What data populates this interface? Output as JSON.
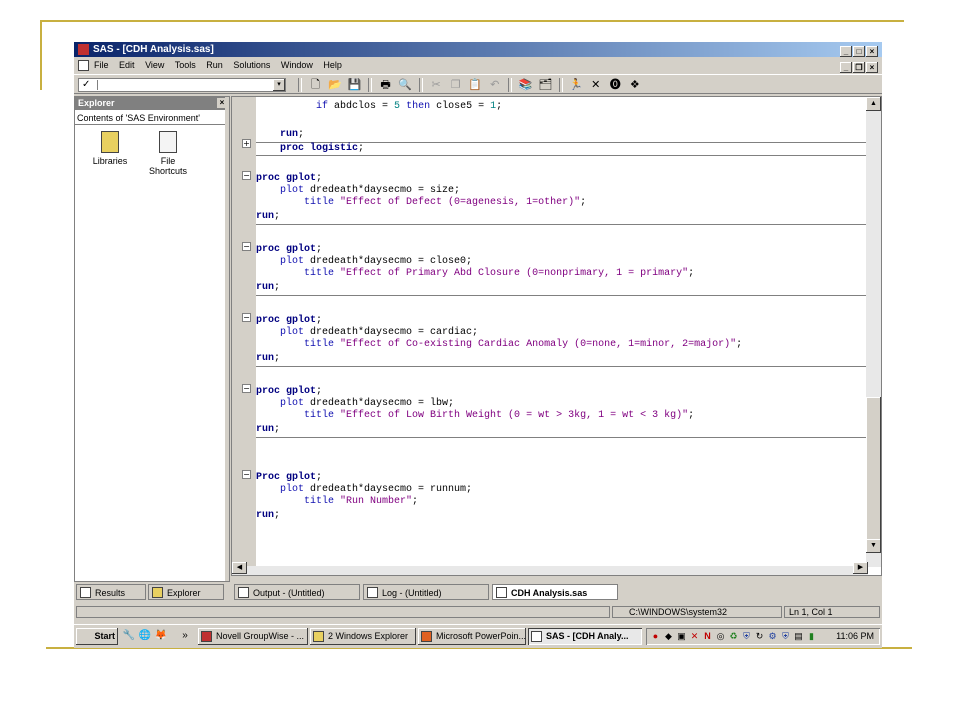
{
  "window": {
    "title": "SAS - [CDH Analysis.sas]",
    "controls": {
      "minimize": "_",
      "maximize": "□",
      "close": "×",
      "restore": "❐"
    }
  },
  "menu": [
    "File",
    "Edit",
    "View",
    "Tools",
    "Run",
    "Solutions",
    "Window",
    "Help"
  ],
  "toolbar": {
    "command_check": "✓",
    "dropdown_arrow": "▾",
    "icons": [
      "new-icon",
      "open-icon",
      "save-icon",
      "print-icon",
      "print-preview-icon",
      "cut-icon",
      "copy-icon",
      "paste-icon",
      "undo-icon",
      "library-icon",
      "explorer-icon",
      "run-icon",
      "clear-icon",
      "break-icon",
      "help-icon"
    ]
  },
  "explorer": {
    "title": "Explorer",
    "close": "×",
    "contents_label": "Contents of 'SAS Environment'",
    "items": [
      {
        "label": "Libraries",
        "icon": "libraries-icon"
      },
      {
        "label": "File Shortcuts",
        "icon": "file-shortcuts-icon"
      }
    ]
  },
  "editor": {
    "lines": {
      "l1": {
        "indent": "          ",
        "kw1": "if",
        "t1": " abdclos = ",
        "num": "5",
        "t2": " ",
        "kw2": "then",
        "t3": " close5 = ",
        "num2": "1",
        "t4": ";"
      },
      "l2": {
        "indent": "    ",
        "kw": "run",
        "t": ";"
      },
      "l3": {
        "indent": "    ",
        "kw": "proc logistic",
        "t": ";"
      },
      "b1": {
        "head": "proc gplot",
        "t": ";",
        "plot_kw": "plot",
        "plot": " dredeath*daysecmo = size;",
        "title_kw": "title",
        "title_str": " \"Effect of Defect (0=agenesis, 1=other)\"",
        "semi": ";",
        "run": "run",
        "run_semi": ";"
      },
      "b2": {
        "head": "proc gplot",
        "t": ";",
        "plot_kw": "plot",
        "plot": " dredeath*daysecmo = close0;",
        "title_kw": "title",
        "title_str": " \"Effect of Primary Abd Closure (0=nonprimary, 1 = primary\"",
        "semi": ";",
        "run": "run",
        "run_semi": ";"
      },
      "b3": {
        "head": "proc gplot",
        "t": ";",
        "plot_kw": "plot",
        "plot": " dredeath*daysecmo = cardiac;",
        "title_kw": "title",
        "title_str": " \"Effect of Co-existing Cardiac Anomaly (0=none, 1=minor, 2=major)\"",
        "semi": ";",
        "run": "run",
        "run_semi": ";"
      },
      "b4": {
        "head": "proc gplot",
        "t": ";",
        "plot_kw": "plot",
        "plot": " dredeath*daysecmo = lbw;",
        "title_kw": "title",
        "title_str": " \"Effect of Low Birth Weight (0 = wt > 3kg, 1 = wt < 3 kg)\"",
        "semi": ";",
        "run": "run",
        "run_semi": ";"
      },
      "b5": {
        "head": "Proc gplot",
        "t": ";",
        "plot_kw": "plot",
        "plot": " dredeath*daysecmo = runnum;",
        "title_kw": "title",
        "title_str": " \"Run Number\"",
        "semi": ";",
        "run": "run",
        "run_semi": ";"
      }
    },
    "fold_collapsed": "+",
    "fold_expanded": "−",
    "scroll_up": "▲",
    "scroll_down": "▼",
    "scroll_right": "▶",
    "scroll_left": "◀"
  },
  "bottom_tabs": {
    "results": "Results",
    "explorer": "Explorer",
    "output": "Output - (Untitled)",
    "log": "Log - (Untitled)",
    "program": "CDH Analysis.sas"
  },
  "status": {
    "path": "C:\\WINDOWS\\system32",
    "position": "Ln 1, Col 1"
  },
  "taskbar": {
    "start": "Start",
    "more": "»",
    "buttons": [
      "Novell GroupWise - ...",
      "2 Windows Explorer",
      "Microsoft PowerPoin...",
      "SAS - [CDH Analy..."
    ],
    "clock": "11:06 PM"
  }
}
